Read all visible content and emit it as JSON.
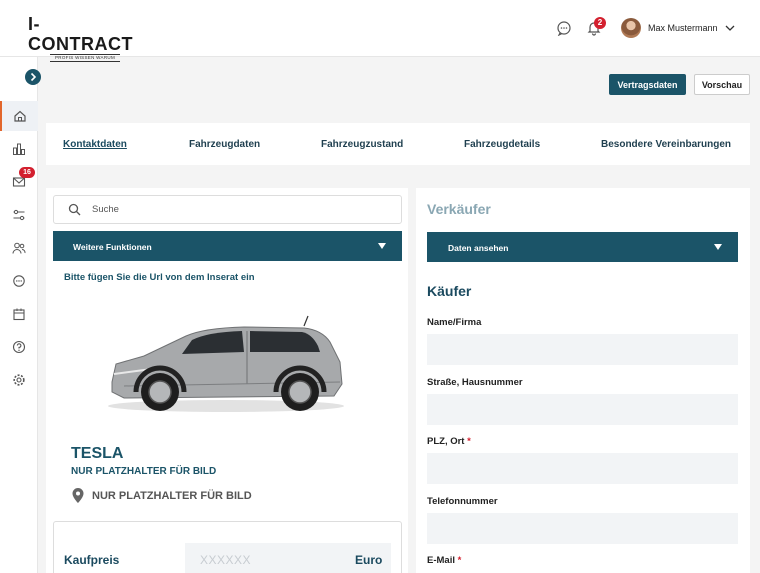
{
  "header": {
    "logo_main": "I-CONTRACT",
    "logo_sub": "PROFIS WISSEN WARUM",
    "notification_count": "2",
    "user_name": "Max Mustermann"
  },
  "sidebar": {
    "mail_badge": "16",
    "items": [
      "home-icon",
      "chart-icon",
      "mail-icon",
      "sliders-icon",
      "users-icon",
      "chat-icon",
      "calendar-icon",
      "help-icon",
      "settings-icon"
    ]
  },
  "actions": {
    "contract_data": "Vertragsdaten",
    "preview": "Vorschau"
  },
  "tabs": [
    {
      "label": "Kontaktdaten"
    },
    {
      "label": "Fahrzeugdaten"
    },
    {
      "label": "Fahrzeugzustand"
    },
    {
      "label": "Fahrzeugdetails"
    },
    {
      "label": "Besondere Vereinbarungen"
    }
  ],
  "left": {
    "search_placeholder": "Suche",
    "more_functions": "Weitere Funktionen",
    "url_hint": "Bitte fügen Sie die Url von dem Inserat ein",
    "brand": "TESLA",
    "brand_sub": "NUR PLATZHALTER FÜR BILD",
    "location": "NUR PLATZHALTER FÜR BILD",
    "price_label": "Kaufpreis",
    "price_placeholder": "XXXXXX",
    "price_unit": "Euro"
  },
  "right": {
    "seller_title": "Verkäufer",
    "view_data": "Daten ansehen",
    "buyer_title": "Käufer",
    "fields": {
      "name": "Name/Firma",
      "street": "Straße, Hausnummer",
      "zip_city": "PLZ, Ort",
      "phone": "Telefonnummer",
      "email": "E-Mail"
    },
    "required_mark": "*"
  },
  "colors": {
    "primary": "#1b5468",
    "accent": "#e2662c",
    "badge": "#d3202f"
  }
}
